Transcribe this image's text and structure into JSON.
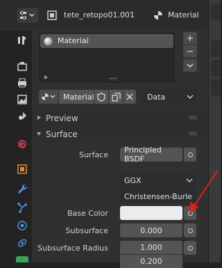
{
  "header": {
    "object_name": "tete_retopo01.001",
    "material_label": "Material"
  },
  "material_slots": {
    "items": [
      {
        "name": "Material"
      }
    ],
    "add_label": "+",
    "remove_label": "−",
    "menu_label": "⌄"
  },
  "material_bar": {
    "name": "Material",
    "link_value": "Data"
  },
  "panels": {
    "preview_label": "Preview",
    "surface_label": "Surface"
  },
  "surface": {
    "surface_label": "Surface",
    "surface_value": "Principled BSDF",
    "distribution_value": "GGX",
    "subsurface_method_value": "Christensen-Burle",
    "base_color_label": "Base Color",
    "base_color_value": "#ececec",
    "subsurface_label": "Subsurface",
    "subsurface_value": "0.000",
    "subsurface_radius_label": "Subsurface Radius",
    "subsurface_radius_values": [
      "1.000",
      "0.200"
    ]
  },
  "colors": {
    "panel_bg": "#303030",
    "tab_active": "#3d3d3d",
    "annotation_arrow": "#e02020"
  }
}
